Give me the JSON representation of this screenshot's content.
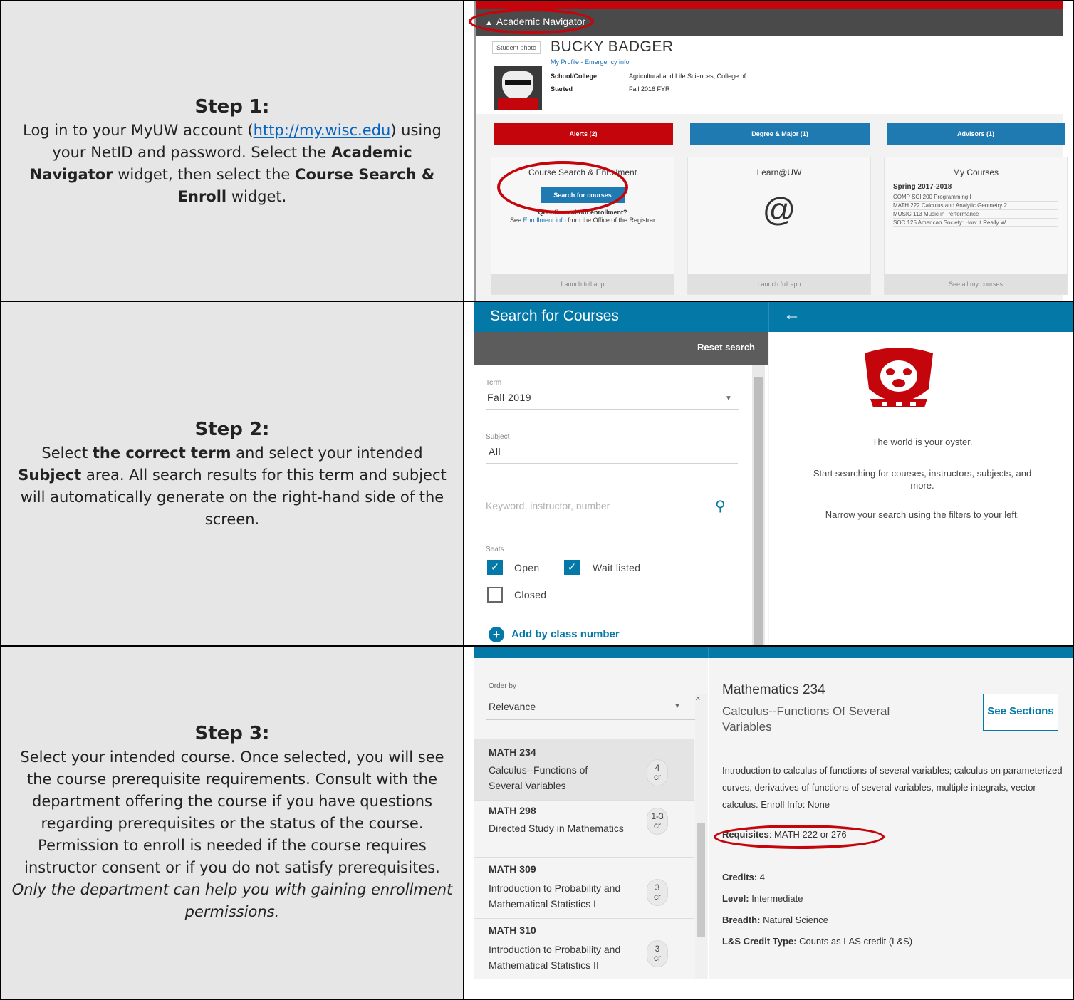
{
  "steps": [
    {
      "heading": "Step 1:",
      "text_a": "Log in to your MyUW account (",
      "link": "http://my.wisc.edu",
      "text_b": ") using your NetID and password. Select the ",
      "bold_a": "Academic Navigator",
      "text_c": " widget, then select the ",
      "bold_b": "Course Search & Enroll",
      "text_d": " widget."
    },
    {
      "heading": "Step 2:",
      "text_a": "Select ",
      "bold_a": "the correct term",
      "text_b": " and select your intended ",
      "bold_b": "Subject",
      "text_c": " area. All search results for this term and subject will automatically generate on the right-hand side of the screen."
    },
    {
      "heading": "Step 3:",
      "text_a": "Select your intended course. Once selected, you will see the course prerequisite requirements. Consult with the department offering the course if you have questions regarding prerequisites or the status of the course. Permission to enroll is needed if the course requires instructor consent or if you do not satisfy prerequisites. ",
      "italic_a": "Only the department can help you with gaining enrollment permissions."
    }
  ],
  "shot1": {
    "nav_title": "Academic Navigator",
    "student_photo": "Student photo",
    "name": "BUCKY BADGER",
    "links": "My Profile - Emergency info",
    "school_label": "School/College",
    "school_value": "Agricultural and Life Sciences, College of",
    "started_label": "Started",
    "started_value": "Fall 2016 FYR",
    "btn_alerts": "Alerts (2)",
    "btn_degree": "Degree & Major (1)",
    "btn_advisors": "Advisors (1)",
    "card1_title": "Course Search & Enrollment",
    "card1_button": "Search for courses",
    "card1_q": "Questions about enrollment?",
    "card1_see": "See ",
    "card1_link": "Enrollment info",
    "card1_rest": " from the Office of the Registrar",
    "card_launch": "Launch full app",
    "card2_title": "Learn@UW",
    "card2_symbol": "@",
    "card3_title": "My Courses",
    "card3_term": "Spring 2017-2018",
    "card3_courses": [
      "COMP SCI 200 Programming I",
      "MATH 222 Calculus and Analytic Geometry 2",
      "MUSIC 113 Music in Performance",
      "SOC 125 American Society: How It Really W..."
    ],
    "card3_foot": "See all my courses",
    "colors": {
      "red": "#c5050c",
      "blue": "#1e7ab1"
    }
  },
  "shot2": {
    "title": "Search for Courses",
    "back_icon": "arrow-left-icon",
    "reset": "Reset search",
    "term_label": "Term",
    "term_value": "Fall 2019",
    "subject_label": "Subject",
    "subject_value": "All",
    "keyword_placeholder": "Keyword, instructor, number",
    "seats_label": "Seats",
    "open": "Open",
    "waitlisted": "Wait listed",
    "closed": "Closed",
    "add_by_class": "Add by class number",
    "msg1": "The world is your oyster.",
    "msg2": "Start searching for courses, instructors, subjects, and more.",
    "msg3": "Narrow your search using the filters to your left."
  },
  "shot3": {
    "order_label": "Order by",
    "order_value": "Relevance",
    "courses": [
      {
        "code": "MATH 234",
        "name": "Calculus--Functions of Several Variables",
        "cr": "4",
        "unit": "cr"
      },
      {
        "code": "MATH 298",
        "name": "Directed Study in Mathematics",
        "cr": "1-3",
        "unit": "cr"
      },
      {
        "code": "MATH 309",
        "name": "Introduction to Probability and Mathematical Statistics I",
        "cr": "3",
        "unit": "cr"
      },
      {
        "code": "MATH 310",
        "name": "Introduction to Probability and Mathematical Statistics II",
        "cr": "3",
        "unit": "cr"
      }
    ],
    "detail_title": "Mathematics 234",
    "detail_sub": "Calculus--Functions Of Several Variables",
    "see_sections": "See Sections",
    "description": "Introduction to calculus of functions of several variables; calculus on parameterized curves, derivatives of functions of several variables, multiple integrals, vector calculus. Enroll Info: None",
    "req_label": "Requisites",
    "req_value": ": MATH 222 or 276",
    "credits_label": "Credits:",
    "credits_value": " 4",
    "level_label": "Level:",
    "level_value": " Intermediate",
    "breadth_label": "Breadth:",
    "breadth_value": " Natural Science",
    "ls_label": "L&S Credit Type:",
    "ls_value": " Counts as LAS credit (L&S)"
  }
}
